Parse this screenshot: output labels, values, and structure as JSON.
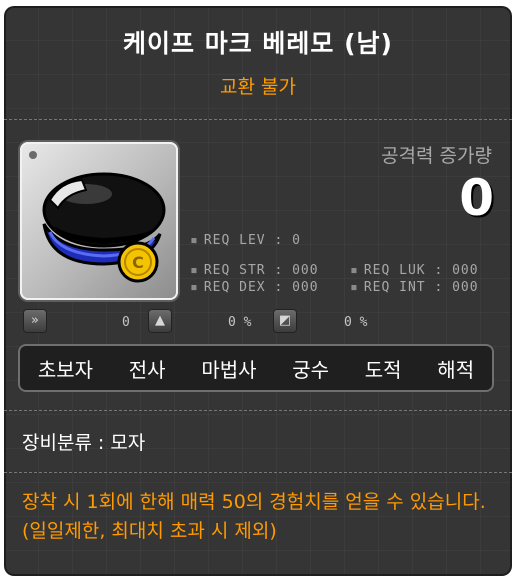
{
  "item": {
    "name": "케이프 마크 베레모 (남)",
    "trade_status": "교환 불가"
  },
  "attack": {
    "label": "공격력 증가량",
    "value": "0"
  },
  "requirements": {
    "lev": "REQ LEV :    0",
    "str": "REQ STR : 000",
    "luk": "REQ LUK : 000",
    "dex": "REQ DEX : 000",
    "int": "REQ INT : 000"
  },
  "stats": {
    "stat1_value": "0",
    "stat2_value": "0 %",
    "stat3_value": "0 %"
  },
  "jobs": [
    "초보자",
    "전사",
    "마법사",
    "궁수",
    "도적",
    "해적"
  ],
  "category": {
    "label": "장비분류",
    "separator": ":",
    "value": "모자"
  },
  "description": "장착 시 1회에 한해 매력 50의 경험치를 얻을 수 있습니다.(일일제한, 최대치 초과 시 제외)",
  "colors": {
    "background": "#353535",
    "accent_orange": "#ff9a00",
    "text_white": "#ffffff",
    "text_gray": "#a7a7a7"
  },
  "icons": [
    "beret-item-icon",
    "speed-icon",
    "upgrade-icon",
    "defense-icon"
  ]
}
